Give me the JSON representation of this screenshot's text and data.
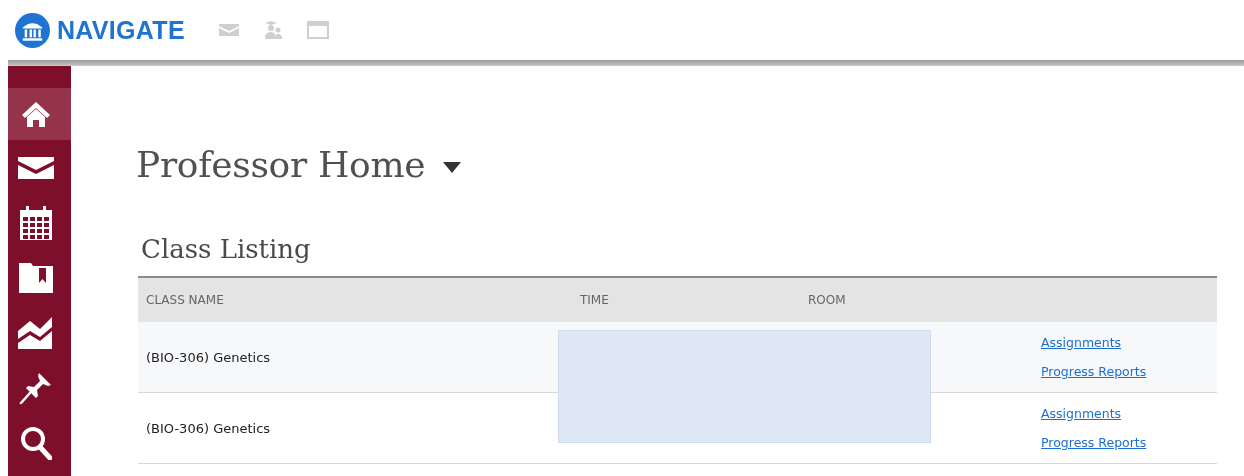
{
  "brand": {
    "name": "NAVIGATE"
  },
  "sidebar": {
    "items": [
      {
        "kind": "home",
        "selected": true
      },
      {
        "kind": "mail",
        "selected": false
      },
      {
        "kind": "calendar",
        "selected": false
      },
      {
        "kind": "folder",
        "selected": false
      },
      {
        "kind": "chart",
        "selected": false
      },
      {
        "kind": "pin",
        "selected": false
      },
      {
        "kind": "search",
        "selected": false
      }
    ]
  },
  "page": {
    "title": "Professor Home"
  },
  "class_listing": {
    "title": "Class Listing",
    "columns": [
      "CLASS NAME",
      "TIME",
      "ROOM"
    ],
    "rows": [
      {
        "class_name": "(BIO-306) Genetics",
        "links": [
          "Assignments",
          "Progress Reports"
        ]
      },
      {
        "class_name": "(BIO-306) Genetics",
        "links": [
          "Assignments",
          "Progress Reports"
        ]
      }
    ]
  }
}
